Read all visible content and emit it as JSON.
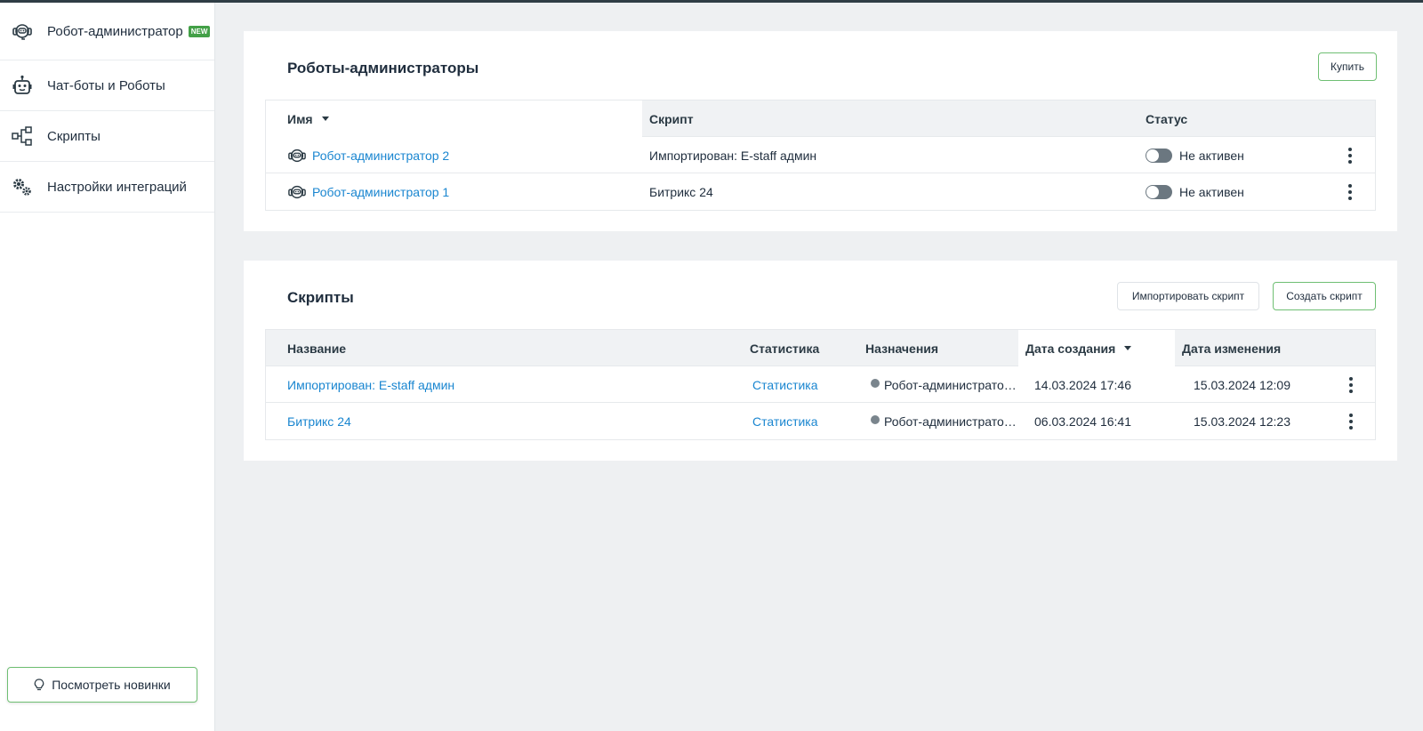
{
  "sidebar": {
    "items": [
      {
        "label": "Робот-администратор",
        "icon": "robot-headset-icon",
        "badge": "NEW"
      },
      {
        "label": "Чат-боты и Роботы",
        "icon": "chatbot-icon"
      },
      {
        "label": "Скрипты",
        "icon": "flow-diagram-icon"
      },
      {
        "label": "Настройки интеграций",
        "icon": "gears-icon"
      }
    ],
    "news_button": "Посмотреть новинки"
  },
  "robots": {
    "title": "Роботы-администраторы",
    "buy_label": "Купить",
    "columns": {
      "name": "Имя",
      "script": "Скрипт",
      "status": "Статус"
    },
    "rows": [
      {
        "name": "Робот-администратор 2",
        "script": "Импортирован: E-staff админ",
        "status": "Не активен"
      },
      {
        "name": "Робот-администратор 1",
        "script": "Битрикс 24",
        "status": "Не активен"
      }
    ]
  },
  "scripts": {
    "title": "Скрипты",
    "import_label": "Импортировать скрипт",
    "create_label": "Создать скрипт",
    "columns": {
      "name": "Название",
      "stats": "Статистика",
      "assign": "Назначения",
      "created": "Дата создания",
      "modified": "Дата изменения"
    },
    "rows": [
      {
        "name": "Импортирован: E-staff админ",
        "stats": "Статистика",
        "assign": "Робот-администрато…",
        "created": "14.03.2024 17:46",
        "modified": "15.03.2024 12:09"
      },
      {
        "name": "Битрикс 24",
        "stats": "Статистика",
        "assign": "Робот-администрато…",
        "created": "06.03.2024 16:41",
        "modified": "15.03.2024 12:23"
      }
    ]
  },
  "colors": {
    "accent": "#1a86d0",
    "green_border": "#6fbf73",
    "badge": "#43a047",
    "background": "#eef0f2"
  }
}
